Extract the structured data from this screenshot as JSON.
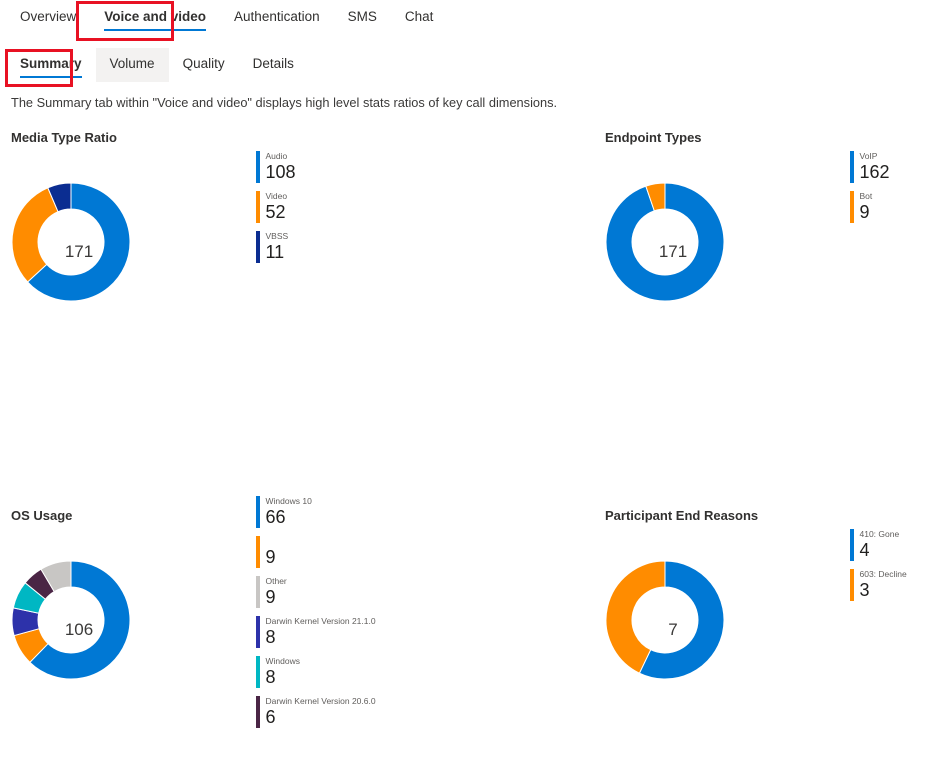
{
  "nav": {
    "primary": [
      {
        "label": "Overview",
        "active": false
      },
      {
        "label": "Voice and video",
        "active": true,
        "highlighted": true
      },
      {
        "label": "Authentication",
        "active": false
      },
      {
        "label": "SMS",
        "active": false
      },
      {
        "label": "Chat",
        "active": false
      }
    ],
    "secondary": [
      {
        "label": "Summary",
        "active": true,
        "highlighted": true,
        "hover": false
      },
      {
        "label": "Volume",
        "active": false,
        "highlighted": false,
        "hover": true
      },
      {
        "label": "Quality",
        "active": false,
        "highlighted": false,
        "hover": false
      },
      {
        "label": "Details",
        "active": false,
        "highlighted": false,
        "hover": false
      }
    ],
    "highlight_color": "#e81123",
    "accent_color": "#0078d4"
  },
  "description": "The Summary tab within \"Voice and video\" displays high level stats ratios of key call dimensions.",
  "chart_data": [
    {
      "id": "media-type-ratio",
      "type": "pie",
      "title": "Media Type Ratio",
      "center_total": "171",
      "categories": [
        "Audio",
        "Video",
        "VBSS"
      ],
      "values": [
        108,
        52,
        11
      ],
      "colors": [
        "#0078d4",
        "#ff8c00",
        "#0b2d91"
      ],
      "legend": "right"
    },
    {
      "id": "endpoint-types",
      "type": "pie",
      "title": "Endpoint Types",
      "center_total": "171",
      "categories": [
        "VoIP",
        "Bot"
      ],
      "values": [
        162,
        9
      ],
      "colors": [
        "#0078d4",
        "#ff8c00"
      ],
      "legend": "right"
    },
    {
      "id": "os-usage",
      "type": "pie",
      "title": "OS Usage",
      "center_total": "106",
      "categories": [
        "Windows 10",
        "",
        "Other",
        "Darwin Kernel Version 21.1.0",
        "Windows",
        "Darwin Kernel Version 20.6.0"
      ],
      "values": [
        66,
        9,
        9,
        8,
        8,
        6
      ],
      "colors": [
        "#0078d4",
        "#ff8c00",
        "#c8c6c4",
        "#2d32aa",
        "#00b7c3",
        "#4a2545"
      ],
      "slice_order": [
        "Windows 10",
        "",
        "Darwin Kernel Version 21.1.0",
        "Windows",
        "Darwin Kernel Version 20.6.0",
        "Other"
      ],
      "legend": "right"
    },
    {
      "id": "participant-end-reasons",
      "type": "pie",
      "title": "Participant End Reasons",
      "center_total": "7",
      "categories": [
        "410: Gone",
        "603: Decline"
      ],
      "values": [
        4,
        3
      ],
      "colors": [
        "#0078d4",
        "#ff8c00"
      ],
      "legend": "right"
    }
  ]
}
